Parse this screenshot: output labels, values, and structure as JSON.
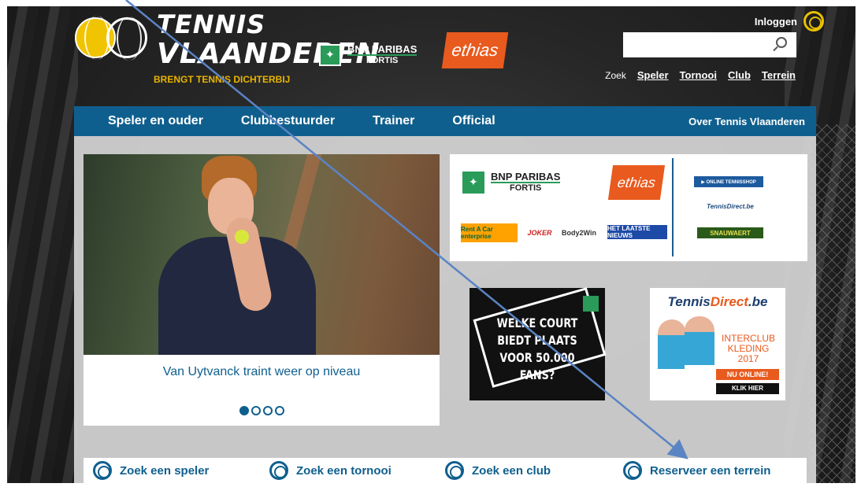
{
  "brand": {
    "name_line1": "TENNIS",
    "name_line2": "VLAANDEREN",
    "tagline": "BRENGT TENNIS DICHTERBIJ"
  },
  "header_sponsors": {
    "bnp_line1": "BNP PARIBAS",
    "bnp_line2": "FORTIS",
    "ethias": "ethias"
  },
  "account": {
    "login_label": "Inloggen"
  },
  "search": {
    "placeholder": "",
    "zoek_label": "Zoek",
    "links": [
      "Speler",
      "Tornooi",
      "Club",
      "Terrein"
    ]
  },
  "nav": {
    "items": [
      "Speler en ouder",
      "Clubbestuurder",
      "Trainer",
      "Official"
    ],
    "right_link": "Over Tennis Vlaanderen"
  },
  "slider": {
    "caption": "Van Uytvanck traint weer op niveau",
    "total_slides": 4,
    "active_slide": 1
  },
  "sponsors": {
    "bnp_line1": "BNP PARIBAS",
    "bnp_line2": "FORTIS",
    "ethias": "ethias",
    "rent_a_car": "Rent A Car enterprise",
    "joker": "JOKER",
    "body2win": "Body2Win",
    "hln": "HET LAATSTE NIEUWS",
    "online_shop": "▶ ONLINE TENNISSHOP",
    "tennisdirect": "TennisDirect.be",
    "snauwaert": "SNAUWAERT"
  },
  "ad_court": {
    "text": "WELKE COURT\nBIEDT PLAATS\nVOOR 50.000 FANS?"
  },
  "ad_tennisdirect": {
    "logo_a": "Tennis",
    "logo_b": "Direct",
    "logo_c": ".be",
    "copy": "INTERCLUB\nKLEDING\n2017",
    "online": "NU ONLINE!",
    "cta": "KLIK HIER"
  },
  "quick_links": [
    "Zoek een speler",
    "Zoek een tornooi",
    "Zoek een club",
    "Reserveer een terrein"
  ],
  "colors": {
    "nav_blue": "#0f5f8e",
    "brand_yellow": "#e8c000",
    "ethias_orange": "#e85a1e",
    "bnp_green": "#2a9b58",
    "annotation_arrow": "#5b84c4"
  }
}
